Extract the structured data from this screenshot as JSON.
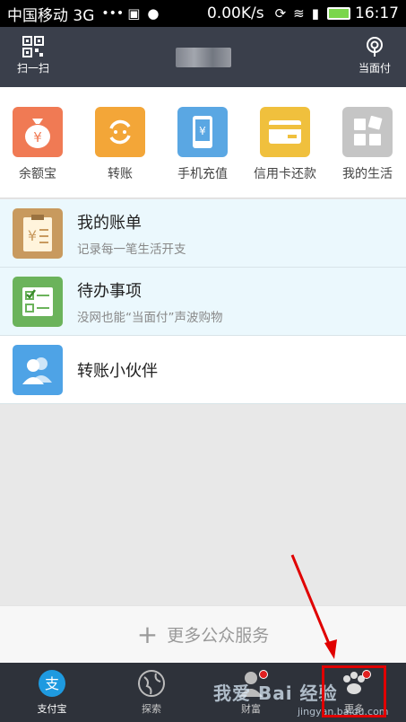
{
  "status_bar": {
    "carrier": "中国移动 3G",
    "indicators": "•••",
    "speed": "0.00K/s",
    "time": "16:17"
  },
  "top_bar": {
    "scan_label": "扫一扫",
    "pay_label": "当面付"
  },
  "apps": [
    {
      "label": "余额宝",
      "icon": "money-bag-icon",
      "color": "#f07a54"
    },
    {
      "label": "转账",
      "icon": "transfer-icon",
      "color": "#f3a638"
    },
    {
      "label": "手机充值",
      "icon": "phone-recharge-icon",
      "color": "#5aa7e3"
    },
    {
      "label": "信用卡还款",
      "icon": "credit-card-icon",
      "color": "#f0c03d"
    },
    {
      "label": "我的生活",
      "icon": "my-life-icon",
      "color": "#c5c5c5"
    }
  ],
  "list": [
    {
      "title": "我的账单",
      "subtitle": "记录每一笔生活开支",
      "icon": "bill-icon"
    },
    {
      "title": "待办事项",
      "subtitle": "没网也能“当面付”声波购物",
      "icon": "todo-icon"
    },
    {
      "title": "转账小伙伴",
      "subtitle": "",
      "icon": "friends-icon"
    }
  ],
  "more_services": {
    "label": "更多公众服务"
  },
  "tabs": [
    {
      "label": "支付宝",
      "icon": "alipay-icon",
      "active": true
    },
    {
      "label": "探索",
      "icon": "explore-globe-icon",
      "active": false
    },
    {
      "label": "财富",
      "icon": "wealth-icon",
      "active": false
    },
    {
      "label": "更多",
      "icon": "more-icon",
      "active": false
    }
  ],
  "watermark": {
    "main": "我爱 Bai 经验",
    "sub": "jingyan.baidu.com"
  },
  "colors": {
    "header_bg": "#3a3f4b",
    "tabbar_bg": "#2e323a",
    "list_tint": "#ebf8fd",
    "highlight": "#e00000"
  }
}
